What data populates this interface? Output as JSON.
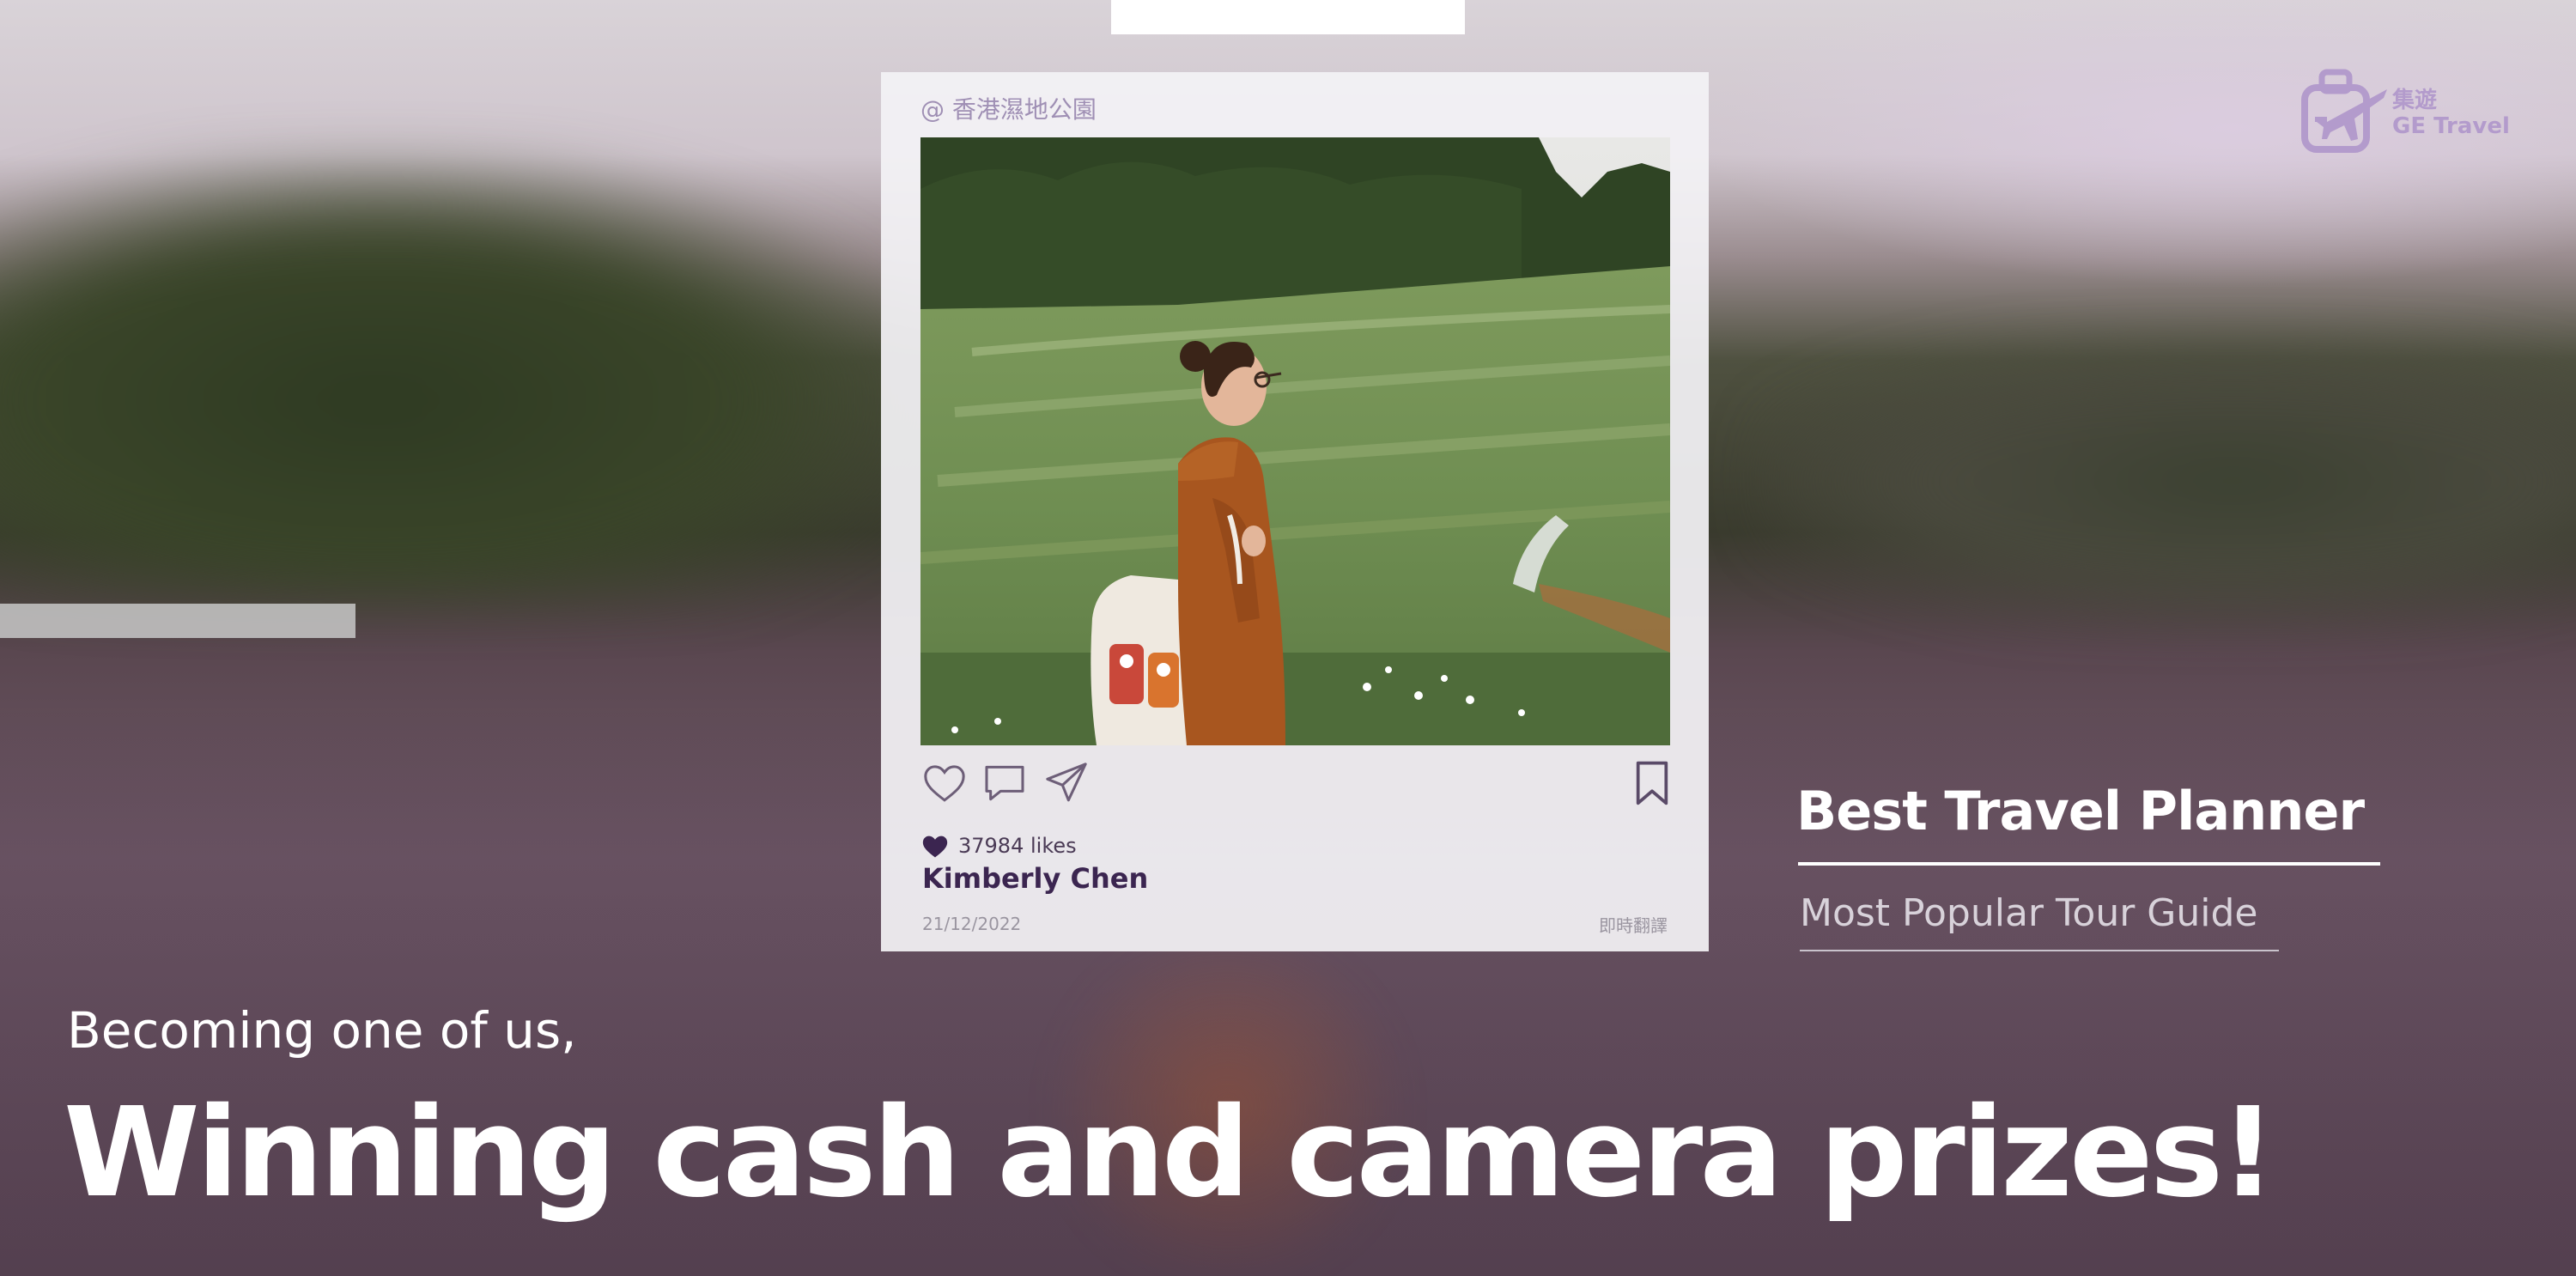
{
  "logo": {
    "name_cn": "集遊",
    "name_en": "GE Travel",
    "icon": "suitcase-airplane-icon",
    "color": "#b39bcc"
  },
  "post": {
    "location": "@ 香港濕地公園",
    "likes_text": "37984 likes",
    "username": "Kimberly Chen",
    "date": "21/12/2022",
    "translate_label": "即時翻譯",
    "icons": {
      "like": "heart-icon",
      "comment": "comment-icon",
      "share": "send-icon",
      "save": "bookmark-icon",
      "liked": "heart-filled-icon"
    },
    "accent": "#3b2550"
  },
  "side": {
    "title": "Best Travel Planner",
    "subtitle": "Most Popular Tour Guide"
  },
  "banner": {
    "subhead": "Becoming one of us,",
    "headline": "Winning cash and camera prizes!"
  }
}
